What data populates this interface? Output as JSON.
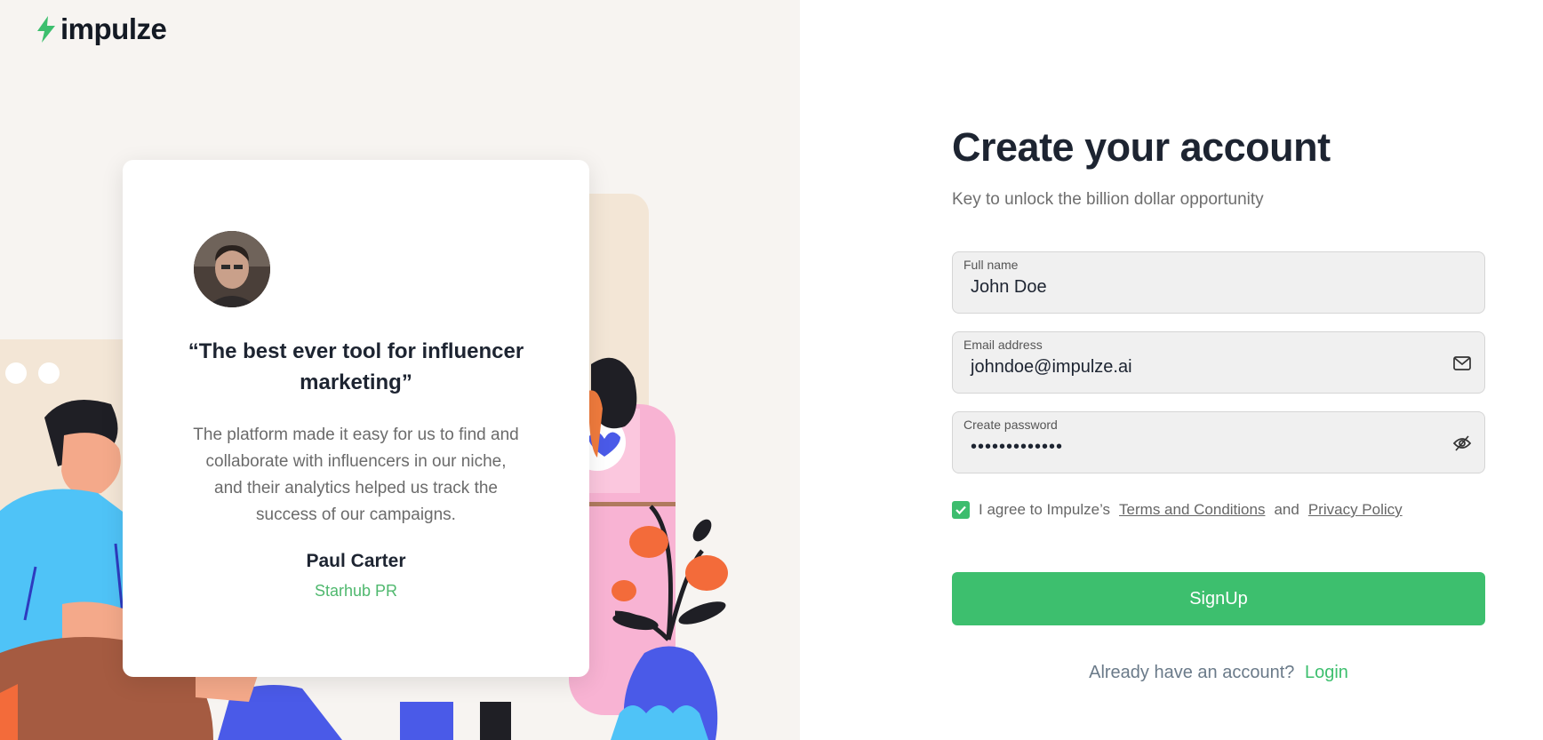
{
  "brand": {
    "name": "impulze",
    "accent": "#3dbf6e",
    "logo_icon": "bolt-icon"
  },
  "testimonial": {
    "quote": "“The best ever tool for influencer marketing”",
    "body": "The platform made it easy for us to find and collaborate with influencers in our niche, and their analytics helped us track the success of our campaigns.",
    "name": "Paul Carter",
    "company": "Starhub PR"
  },
  "form": {
    "title": "Create your account",
    "subtitle": "Key to unlock the billion dollar opportunity",
    "fullname": {
      "label": "Full name",
      "value": "John Doe"
    },
    "email": {
      "label": "Email address",
      "value": "johndoe@impulze.ai",
      "icon": "mail-icon"
    },
    "password": {
      "label": "Create password",
      "value": "•••••••••••••",
      "icon": "eye-off-icon"
    },
    "agree": {
      "prefix": "I agree to Impulze’s",
      "terms": "Terms and Conditions",
      "and": "and",
      "privacy": "Privacy Policy",
      "checked": true
    },
    "submit": "SignUp",
    "login_prompt": "Already have an account?",
    "login_link": "Login"
  }
}
